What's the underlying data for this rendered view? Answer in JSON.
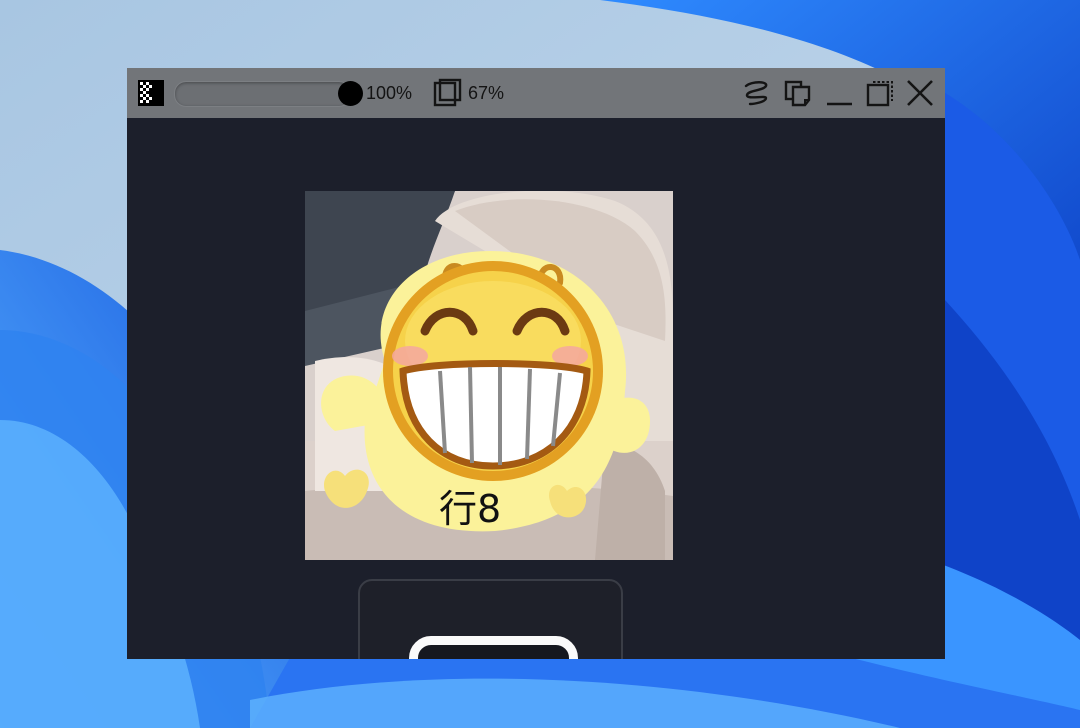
{
  "window": {
    "opacity_percent": 1.0,
    "opacity_label": "100%",
    "zoom_label": "67%"
  },
  "image": {
    "caption": "行8",
    "description_colors": {
      "face": "#f6d24a",
      "rim": "#e0a01f",
      "body": "#fbf29a",
      "background": "#cfc6c3"
    }
  },
  "icons": {
    "transparency": "checkerboard-icon",
    "crop": "crop-frame-icon",
    "signature": "scribble-icon",
    "copy": "copy-paste-icon",
    "minimize": "minimize-icon",
    "restore": "restore-icon",
    "close": "close-icon"
  },
  "colors": {
    "titlebar": "#727579",
    "viewer_bg": "#1c1f2b",
    "desktop_accent": "#1a5fe0"
  }
}
